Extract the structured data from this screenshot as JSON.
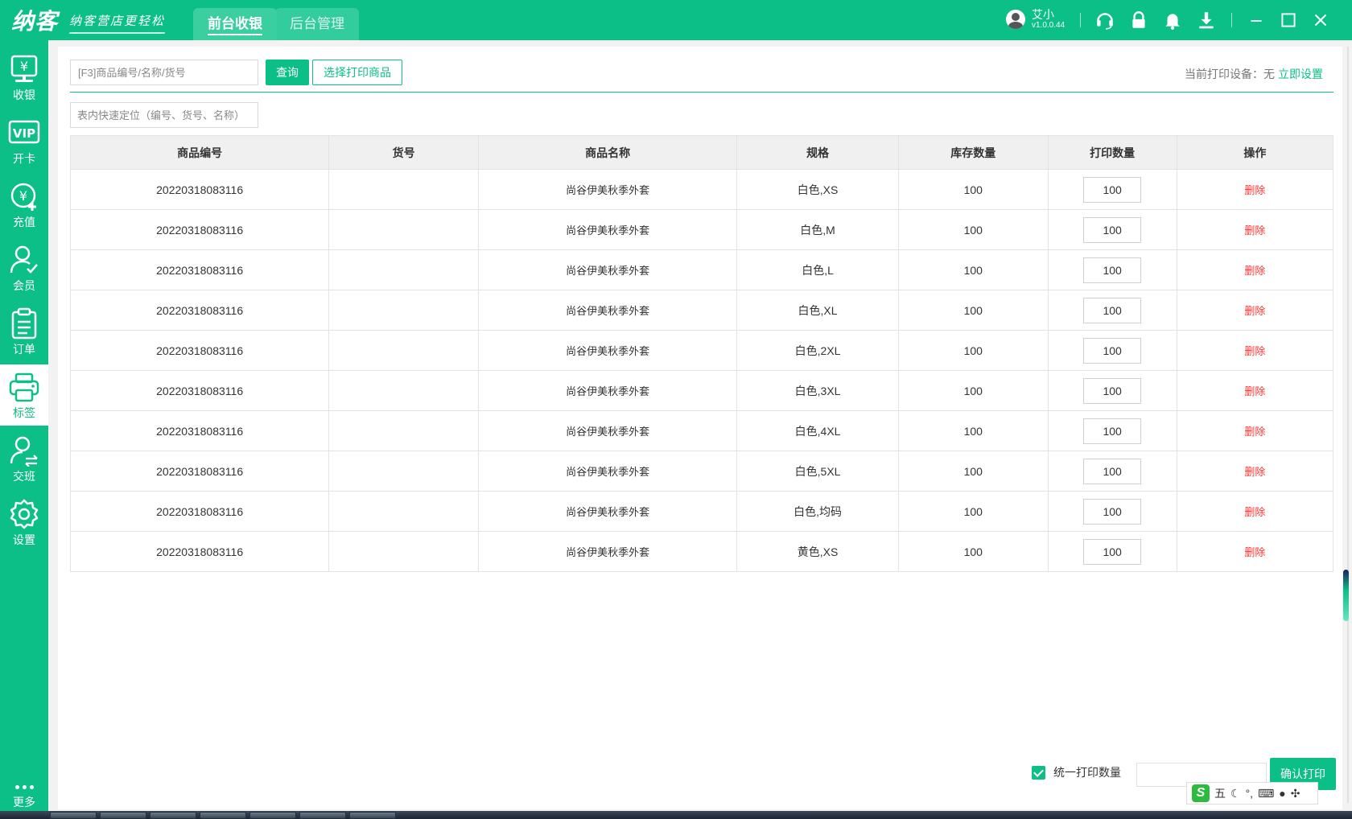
{
  "app": {
    "logo": "纳客",
    "slogan": "纳客营店更轻松",
    "tabs": [
      "前台收银",
      "后台管理"
    ],
    "user_name": "艾小",
    "version": "v1.0.0.44"
  },
  "top_icons": [
    "headset-icon",
    "lock-icon",
    "bell-icon",
    "download-icon"
  ],
  "window_controls": [
    "minimize-icon",
    "maximize-icon",
    "close-icon"
  ],
  "sidebar": {
    "items": [
      {
        "label": "收银",
        "icon": "cashier-icon"
      },
      {
        "label": "开卡",
        "icon": "vip-card-icon"
      },
      {
        "label": "充值",
        "icon": "recharge-icon"
      },
      {
        "label": "会员",
        "icon": "member-icon"
      },
      {
        "label": "订单",
        "icon": "order-icon"
      },
      {
        "label": "标签",
        "icon": "printer-icon"
      },
      {
        "label": "交班",
        "icon": "shift-icon"
      },
      {
        "label": "设置",
        "icon": "gear-icon"
      }
    ],
    "more_label": "更多"
  },
  "toolbar": {
    "search_placeholder": "[F3]商品编号/名称/货号",
    "query_label": "查询",
    "select_label": "选择打印商品",
    "printer_text": "当前打印设备：无",
    "printer_link": "立即设置",
    "locate_placeholder": "表内快速定位（编号、货号、名称）"
  },
  "table": {
    "headers": [
      "商品编号",
      "货号",
      "商品名称",
      "规格",
      "库存数量",
      "打印数量",
      "操作"
    ],
    "rows": [
      {
        "code": "20220318083116",
        "sku": "",
        "name": "尚谷伊美秋季外套",
        "spec": "白色,XS",
        "stock": "100",
        "print_qty": "100",
        "action": "删除"
      },
      {
        "code": "20220318083116",
        "sku": "",
        "name": "尚谷伊美秋季外套",
        "spec": "白色,M",
        "stock": "100",
        "print_qty": "100",
        "action": "删除"
      },
      {
        "code": "20220318083116",
        "sku": "",
        "name": "尚谷伊美秋季外套",
        "spec": "白色,L",
        "stock": "100",
        "print_qty": "100",
        "action": "删除"
      },
      {
        "code": "20220318083116",
        "sku": "",
        "name": "尚谷伊美秋季外套",
        "spec": "白色,XL",
        "stock": "100",
        "print_qty": "100",
        "action": "删除"
      },
      {
        "code": "20220318083116",
        "sku": "",
        "name": "尚谷伊美秋季外套",
        "spec": "白色,2XL",
        "stock": "100",
        "print_qty": "100",
        "action": "删除"
      },
      {
        "code": "20220318083116",
        "sku": "",
        "name": "尚谷伊美秋季外套",
        "spec": "白色,3XL",
        "stock": "100",
        "print_qty": "100",
        "action": "删除"
      },
      {
        "code": "20220318083116",
        "sku": "",
        "name": "尚谷伊美秋季外套",
        "spec": "白色,4XL",
        "stock": "100",
        "print_qty": "100",
        "action": "删除"
      },
      {
        "code": "20220318083116",
        "sku": "",
        "name": "尚谷伊美秋季外套",
        "spec": "白色,5XL",
        "stock": "100",
        "print_qty": "100",
        "action": "删除"
      },
      {
        "code": "20220318083116",
        "sku": "",
        "name": "尚谷伊美秋季外套",
        "spec": "白色,均码",
        "stock": "100",
        "print_qty": "100",
        "action": "删除"
      },
      {
        "code": "20220318083116",
        "sku": "",
        "name": "尚谷伊美秋季外套",
        "spec": "黄色,XS",
        "stock": "100",
        "print_qty": "100",
        "action": "删除"
      }
    ]
  },
  "footer": {
    "unify_label": "统一打印数量",
    "unify_checked": true,
    "confirm_label": "确认打印"
  },
  "ime": {
    "mode": "五"
  },
  "colors": {
    "brand": "#0bbf86",
    "delete": "#ff3333"
  }
}
